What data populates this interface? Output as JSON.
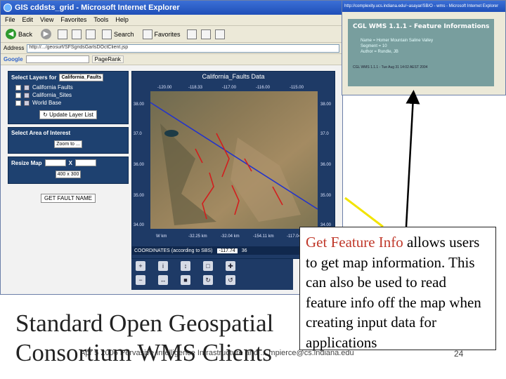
{
  "ie_window": {
    "title": "GIS cddsts_grid - Microsoft Internet Explorer",
    "menu": [
      "File",
      "Edit",
      "View",
      "Favorites",
      "Tools",
      "Help"
    ],
    "toolbar": {
      "back": "Back",
      "search": "Search",
      "favorites": "Favorites"
    },
    "address_label": "Address",
    "address_value": "http://.../geosurf/SFSgridsGarlsDOctClient.jsp",
    "google": {
      "logo": "Google",
      "pagerank": "PageRank"
    }
  },
  "left_panel": {
    "select_layers_label": "Select Layers for",
    "layer_select_value": "California_Faults",
    "layers": [
      "California Faults",
      "California_Sites",
      "World Base"
    ],
    "update_button": "Update Layer List",
    "select_area_label": "Select Area of Interest",
    "zoom_select_value": "Zoom to ...",
    "resize_label": "Resize Map",
    "resize_x_sep": "X",
    "size_select_value": "400 x 300",
    "get_fault_button": "GET FAULT NAME"
  },
  "map": {
    "title": "California_Faults Data",
    "top_ticks": [
      "-120.00",
      "-118.33",
      "-117.00",
      "-116.00",
      "-115.00"
    ],
    "left_ticks": [
      "38.00",
      "37.0",
      "36.00",
      "35.00",
      "34.00"
    ],
    "right_ticks": [
      "38.00",
      "37.0",
      "36.00",
      "35.00",
      "34.00"
    ],
    "bottom_ticks": [
      "W km",
      "-32.25 km",
      "-32.04 km",
      "-154.11 km",
      "-117.04 km"
    ],
    "coords_label": "COORDINATES (according to SBS)",
    "coords_lon": "-117.74",
    "coords_lat": "36"
  },
  "info_window": {
    "title": "http://complexity.ucs.indiana.edu/~asayar/SB/O - wms - Microsoft Internet Explorer",
    "header": "CGL WMS 1.1.1 - Feature Informations",
    "lines": [
      "Name = Homer Mountain Saline Valley",
      "Segment = 10",
      "Author = Rundle, JB"
    ],
    "footer": "CGL WMS 1.1.1 - Tue Aug 31 14:02 AEST 2004"
  },
  "slide": {
    "callout_highlight": "Get Feature Info",
    "callout_rest": " allows users to get map information.  This can also be used to read feature info off the map when creating input data for applications",
    "title_line1": "Standard Open Geospatial",
    "title_line2": "Consortium WMS Clients",
    "footer": "Apr 5 2006  Pervasive Intelligence Infrastructure and ... mpierce@cs.indiana.edu",
    "page_number": "24"
  }
}
